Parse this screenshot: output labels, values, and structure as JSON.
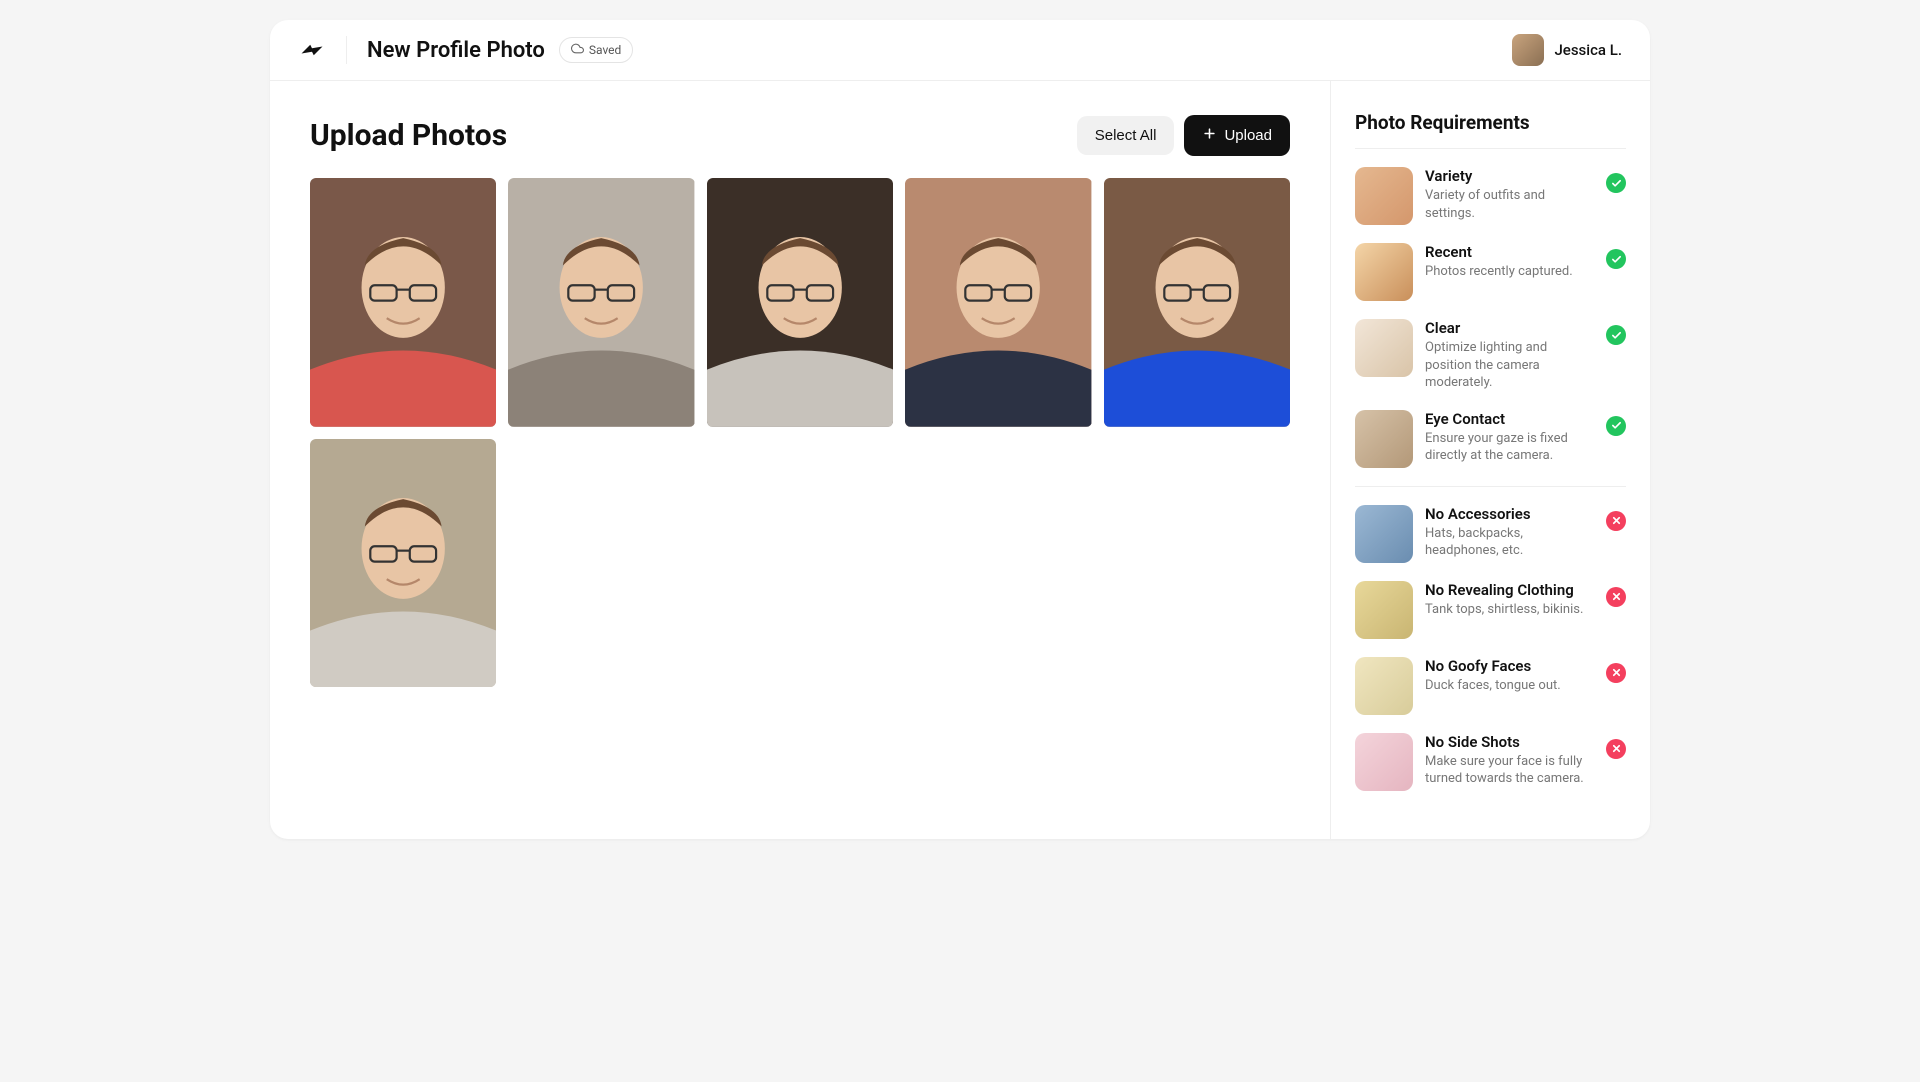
{
  "header": {
    "page_title": "New Profile Photo",
    "saved_label": "Saved",
    "user_name": "Jessica L."
  },
  "main": {
    "title": "Upload Photos",
    "select_all_label": "Select All",
    "upload_label": "Upload",
    "photos": [
      {
        "name": "photo-1",
        "bg": "t-red"
      },
      {
        "name": "photo-2",
        "bg": "t-gray"
      },
      {
        "name": "photo-3",
        "bg": "t-dark"
      },
      {
        "name": "photo-4",
        "bg": "t-brick"
      },
      {
        "name": "photo-5",
        "bg": "t-blue"
      },
      {
        "name": "photo-6",
        "bg": "t-beige"
      }
    ]
  },
  "sidebar": {
    "title": "Photo Requirements",
    "good": [
      {
        "title": "Variety",
        "desc": "Variety of outfits and settings.",
        "thumb": "rt-1"
      },
      {
        "title": "Recent",
        "desc": "Photos recently captured.",
        "thumb": "rt-2"
      },
      {
        "title": "Clear",
        "desc": "Optimize lighting and position the camera moderately.",
        "thumb": "rt-3"
      },
      {
        "title": "Eye Contact",
        "desc": "Ensure your gaze is fixed directly at the camera.",
        "thumb": "rt-4"
      }
    ],
    "bad": [
      {
        "title": "No Accessories",
        "desc": "Hats, backpacks, headphones, etc.",
        "thumb": "rt-5"
      },
      {
        "title": "No Revealing Clothing",
        "desc": "Tank tops, shirtless, bikinis.",
        "thumb": "rt-6"
      },
      {
        "title": "No Goofy Faces",
        "desc": "Duck faces, tongue out.",
        "thumb": "rt-7"
      },
      {
        "title": "No Side Shots",
        "desc": "Make sure your face is fully turned towards the camera.",
        "thumb": "rt-8"
      }
    ]
  }
}
